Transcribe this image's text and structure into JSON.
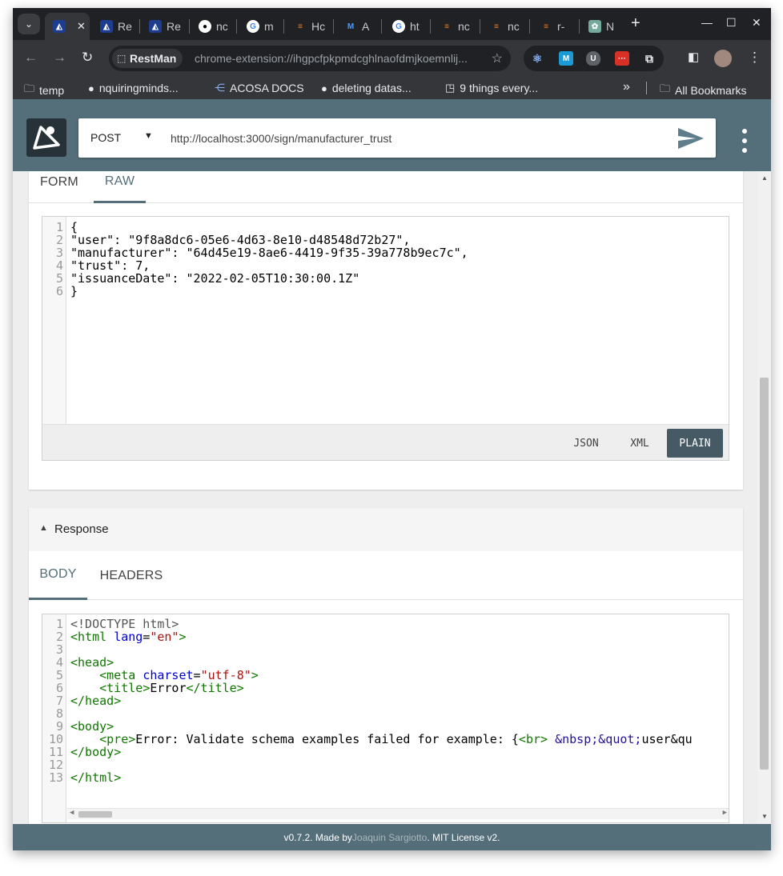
{
  "browser": {
    "tabs": [
      {
        "label": "",
        "icon": "restman-icon",
        "active": true
      },
      {
        "label": "Re",
        "icon": "restman-icon"
      },
      {
        "label": "Re",
        "icon": "restman-icon"
      },
      {
        "label": "nc",
        "icon": "github-icon"
      },
      {
        "label": "m",
        "icon": "google-icon"
      },
      {
        "label": "Hc",
        "icon": "stackoverflow-icon"
      },
      {
        "label": "A",
        "icon": "atlassian-icon"
      },
      {
        "label": "ht",
        "icon": "google-icon"
      },
      {
        "label": "nc",
        "icon": "stackoverflow-icon"
      },
      {
        "label": "nc",
        "icon": "stackoverflow-icon"
      },
      {
        "label": "r-",
        "icon": "stackoverflow-icon"
      },
      {
        "label": "N",
        "icon": "openai-icon"
      }
    ],
    "new_tab": "+",
    "site_chip": "RestMan",
    "url": "chrome-extension://ihgpcfpkpmdcghlnaofdmjkoemnlij...",
    "bookmarks": [
      {
        "label": "temp",
        "icon": "folder-icon"
      },
      {
        "label": "nquiringminds...",
        "icon": "github-icon"
      },
      {
        "label": "ACOSA DOCS",
        "icon": "share-icon"
      },
      {
        "label": "deleting datas...",
        "icon": "github-icon"
      },
      {
        "label": "9 things every...",
        "icon": "bracket-icon"
      }
    ],
    "more_bookmarks": "»",
    "all_bookmarks": "All Bookmarks"
  },
  "request": {
    "method": "POST",
    "url": "http://localhost:3000/sign/manufacturer_trust"
  },
  "body_card": {
    "tabs": [
      "FORM",
      "RAW"
    ],
    "selected_tab": "RAW",
    "lines": [
      "{",
      "\"user\": \"9f8a8dc6-05e6-4d63-8e10-d48548d72b27\",",
      "\"manufacturer\": \"64d45e19-8ae6-4419-9f35-39a778b9ec7c\",",
      "\"trust\": 7,",
      "\"issuanceDate\": \"2022-02-05T10:30:00.1Z\"",
      "}"
    ],
    "formats": [
      "JSON",
      "XML",
      "PLAIN"
    ],
    "selected_format": "PLAIN"
  },
  "response": {
    "title": "Response",
    "tabs": [
      "BODY",
      "HEADERS"
    ],
    "selected_tab": "BODY",
    "line_count": 13,
    "line_texts": {
      "1": "<!DOCTYPE html>",
      "2": "<html lang=\"en\">",
      "4": "<head>",
      "5": "<meta charset=\"utf-8\">",
      "6": "<title>Error</title>",
      "7": "</head>",
      "9": "<body>",
      "10": "<pre>Error: Validate schema examples failed for example: {<br> &nbsp;&quot;user&qu",
      "11": "</body>",
      "13": "</html>"
    }
  },
  "footer": {
    "version": "v0.7.2. Made by ",
    "author": "Joaquin Sargiotto",
    "license": ". MIT License v2."
  },
  "colors": {
    "accent": "#546e7a",
    "accent_dark": "#455a64",
    "chrome_dark": "#202124",
    "chrome_toolbar": "#35363a"
  }
}
